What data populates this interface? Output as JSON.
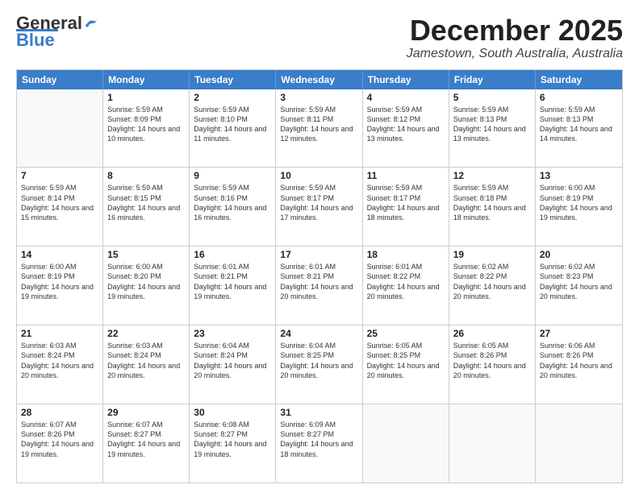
{
  "header": {
    "logo": {
      "general": "General",
      "blue": "Blue"
    },
    "title": "December 2025",
    "subtitle": "Jamestown, South Australia, Australia"
  },
  "calendar": {
    "days_of_week": [
      "Sunday",
      "Monday",
      "Tuesday",
      "Wednesday",
      "Thursday",
      "Friday",
      "Saturday"
    ],
    "rows": [
      [
        {
          "day": "",
          "empty": true
        },
        {
          "day": "1",
          "sunrise": "5:59 AM",
          "sunset": "8:09 PM",
          "daylight": "14 hours and 10 minutes."
        },
        {
          "day": "2",
          "sunrise": "5:59 AM",
          "sunset": "8:10 PM",
          "daylight": "14 hours and 11 minutes."
        },
        {
          "day": "3",
          "sunrise": "5:59 AM",
          "sunset": "8:11 PM",
          "daylight": "14 hours and 12 minutes."
        },
        {
          "day": "4",
          "sunrise": "5:59 AM",
          "sunset": "8:12 PM",
          "daylight": "14 hours and 13 minutes."
        },
        {
          "day": "5",
          "sunrise": "5:59 AM",
          "sunset": "8:13 PM",
          "daylight": "14 hours and 13 minutes."
        },
        {
          "day": "6",
          "sunrise": "5:59 AM",
          "sunset": "8:13 PM",
          "daylight": "14 hours and 14 minutes."
        }
      ],
      [
        {
          "day": "7",
          "sunrise": "5:59 AM",
          "sunset": "8:14 PM",
          "daylight": "14 hours and 15 minutes."
        },
        {
          "day": "8",
          "sunrise": "5:59 AM",
          "sunset": "8:15 PM",
          "daylight": "14 hours and 16 minutes."
        },
        {
          "day": "9",
          "sunrise": "5:59 AM",
          "sunset": "8:16 PM",
          "daylight": "14 hours and 16 minutes."
        },
        {
          "day": "10",
          "sunrise": "5:59 AM",
          "sunset": "8:17 PM",
          "daylight": "14 hours and 17 minutes."
        },
        {
          "day": "11",
          "sunrise": "5:59 AM",
          "sunset": "8:17 PM",
          "daylight": "14 hours and 18 minutes."
        },
        {
          "day": "12",
          "sunrise": "5:59 AM",
          "sunset": "8:18 PM",
          "daylight": "14 hours and 18 minutes."
        },
        {
          "day": "13",
          "sunrise": "6:00 AM",
          "sunset": "8:19 PM",
          "daylight": "14 hours and 19 minutes."
        }
      ],
      [
        {
          "day": "14",
          "sunrise": "6:00 AM",
          "sunset": "8:19 PM",
          "daylight": "14 hours and 19 minutes."
        },
        {
          "day": "15",
          "sunrise": "6:00 AM",
          "sunset": "8:20 PM",
          "daylight": "14 hours and 19 minutes."
        },
        {
          "day": "16",
          "sunrise": "6:01 AM",
          "sunset": "8:21 PM",
          "daylight": "14 hours and 19 minutes."
        },
        {
          "day": "17",
          "sunrise": "6:01 AM",
          "sunset": "8:21 PM",
          "daylight": "14 hours and 20 minutes."
        },
        {
          "day": "18",
          "sunrise": "6:01 AM",
          "sunset": "8:22 PM",
          "daylight": "14 hours and 20 minutes."
        },
        {
          "day": "19",
          "sunrise": "6:02 AM",
          "sunset": "8:22 PM",
          "daylight": "14 hours and 20 minutes."
        },
        {
          "day": "20",
          "sunrise": "6:02 AM",
          "sunset": "8:23 PM",
          "daylight": "14 hours and 20 minutes."
        }
      ],
      [
        {
          "day": "21",
          "sunrise": "6:03 AM",
          "sunset": "8:24 PM",
          "daylight": "14 hours and 20 minutes."
        },
        {
          "day": "22",
          "sunrise": "6:03 AM",
          "sunset": "8:24 PM",
          "daylight": "14 hours and 20 minutes."
        },
        {
          "day": "23",
          "sunrise": "6:04 AM",
          "sunset": "8:24 PM",
          "daylight": "14 hours and 20 minutes."
        },
        {
          "day": "24",
          "sunrise": "6:04 AM",
          "sunset": "8:25 PM",
          "daylight": "14 hours and 20 minutes."
        },
        {
          "day": "25",
          "sunrise": "6:05 AM",
          "sunset": "8:25 PM",
          "daylight": "14 hours and 20 minutes."
        },
        {
          "day": "26",
          "sunrise": "6:05 AM",
          "sunset": "8:26 PM",
          "daylight": "14 hours and 20 minutes."
        },
        {
          "day": "27",
          "sunrise": "6:06 AM",
          "sunset": "8:26 PM",
          "daylight": "14 hours and 20 minutes."
        }
      ],
      [
        {
          "day": "28",
          "sunrise": "6:07 AM",
          "sunset": "8:26 PM",
          "daylight": "14 hours and 19 minutes."
        },
        {
          "day": "29",
          "sunrise": "6:07 AM",
          "sunset": "8:27 PM",
          "daylight": "14 hours and 19 minutes."
        },
        {
          "day": "30",
          "sunrise": "6:08 AM",
          "sunset": "8:27 PM",
          "daylight": "14 hours and 19 minutes."
        },
        {
          "day": "31",
          "sunrise": "6:09 AM",
          "sunset": "8:27 PM",
          "daylight": "14 hours and 18 minutes."
        },
        {
          "day": "",
          "empty": true
        },
        {
          "day": "",
          "empty": true
        },
        {
          "day": "",
          "empty": true
        }
      ]
    ]
  }
}
